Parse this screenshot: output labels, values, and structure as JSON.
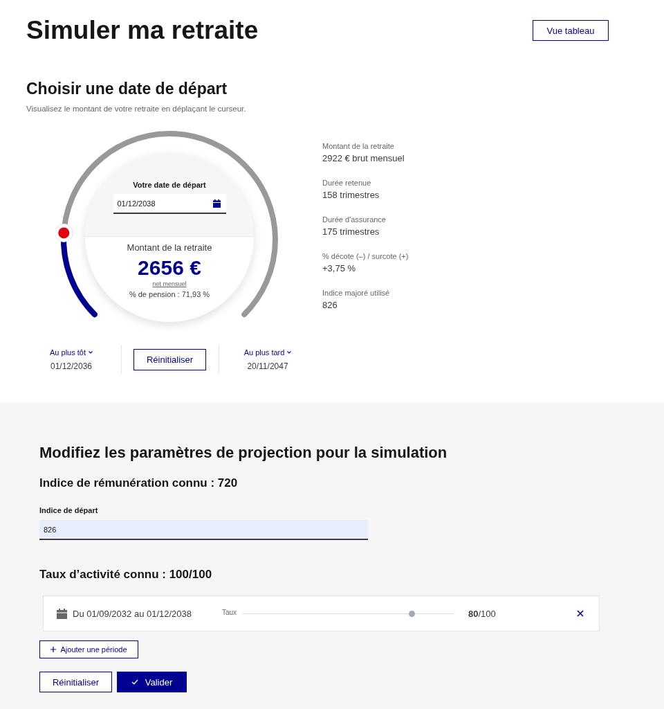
{
  "header": {
    "title": "Simuler ma retraite",
    "view_button": "Vue tableau"
  },
  "departure": {
    "title": "Choisir une date de départ",
    "subtitle": "Visualisez le montant de votre retraite en déplaçant le curseur.",
    "gauge": {
      "level": 0.18,
      "date_label": "Votre date de départ",
      "date_value": "01/12/2038",
      "amount_label": "Montant de la retraite",
      "amount": "2656 €",
      "amount_unit": "net mensuel",
      "pension_rate": "% de pension : 71,93 %"
    },
    "earliest": {
      "label": "Au plus tôt",
      "date": "01/12/2036"
    },
    "reset_button": "Réinitialiser",
    "latest": {
      "label": "Au plus tard",
      "date": "20/11/2047"
    },
    "details": [
      {
        "label": "Montant de la retraite",
        "value": "2922 € brut mensuel"
      },
      {
        "label": "Durée retenue",
        "value": "158 trimestres"
      },
      {
        "label": "Durée d'assurance",
        "value": "175 trimestres"
      },
      {
        "label": "% décote (–) / surcote (+)",
        "value": "+3,75 %"
      },
      {
        "label": "Indice majoré utilisé",
        "value": "826"
      }
    ]
  },
  "projection": {
    "title": "Modifiez les paramètres de projection pour la simulation",
    "index_heading": "Indice de rémunération connu : 720",
    "start_index": {
      "label": "Indice de départ",
      "value": "826"
    },
    "activity_heading": "Taux d’activité connu : 100/100",
    "periods": [
      {
        "dates": "Du 01/09/2032 au 01/12/2038",
        "rate_label": "Taux",
        "level": 0.8,
        "rate": "**80**/100"
      }
    ],
    "add_button": "Ajouter une période",
    "reset_button": "Réinitialiser",
    "submit_button": "Valider"
  }
}
